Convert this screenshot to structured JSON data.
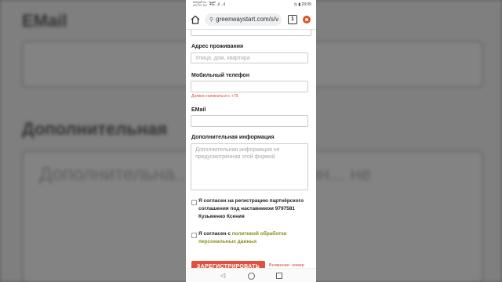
{
  "background": {
    "email_label": "EMail",
    "additional_label": "Дополнительная",
    "additional_placeholder": "Дополнительна... предусмотренн... не"
  },
  "status_bar": {
    "carrier_line1": "MegaFon · Kcell",
    "carrier_line2": "ACTIV KZ",
    "signal": "4G ..ıl ..ıl",
    "right": "◷ ▮ 23:05"
  },
  "browser": {
    "url": "greenwaystart.com/s/v",
    "tabs_count": "1"
  },
  "form": {
    "address_label": "Адрес проживания",
    "address_placeholder": "Улица, дом, квартира",
    "phone_label": "Мобильный телефон",
    "phone_value": "",
    "phone_hint": "Должен начинаться с +79",
    "email_label": "EMail",
    "email_value": "",
    "additional_label": "Дополнительная информация",
    "additional_placeholder": "Дополнительная информация не предусмотренная этой формой",
    "agree_registration": "Я согласен на регистрацию партнёрского соглашения под наставником 9797581 Кузьменко Ксения",
    "agree_policy_prefix": "Я согласен с ",
    "agree_policy_link": "политикой обработки персональных данных",
    "register_button": "ЗАРЕГИСТРИРОВАТЬ",
    "note": "Внимание: номер"
  },
  "colors": {
    "accent": "#e2513f",
    "link": "#8a8f1a",
    "hint": "#d04a3a"
  }
}
